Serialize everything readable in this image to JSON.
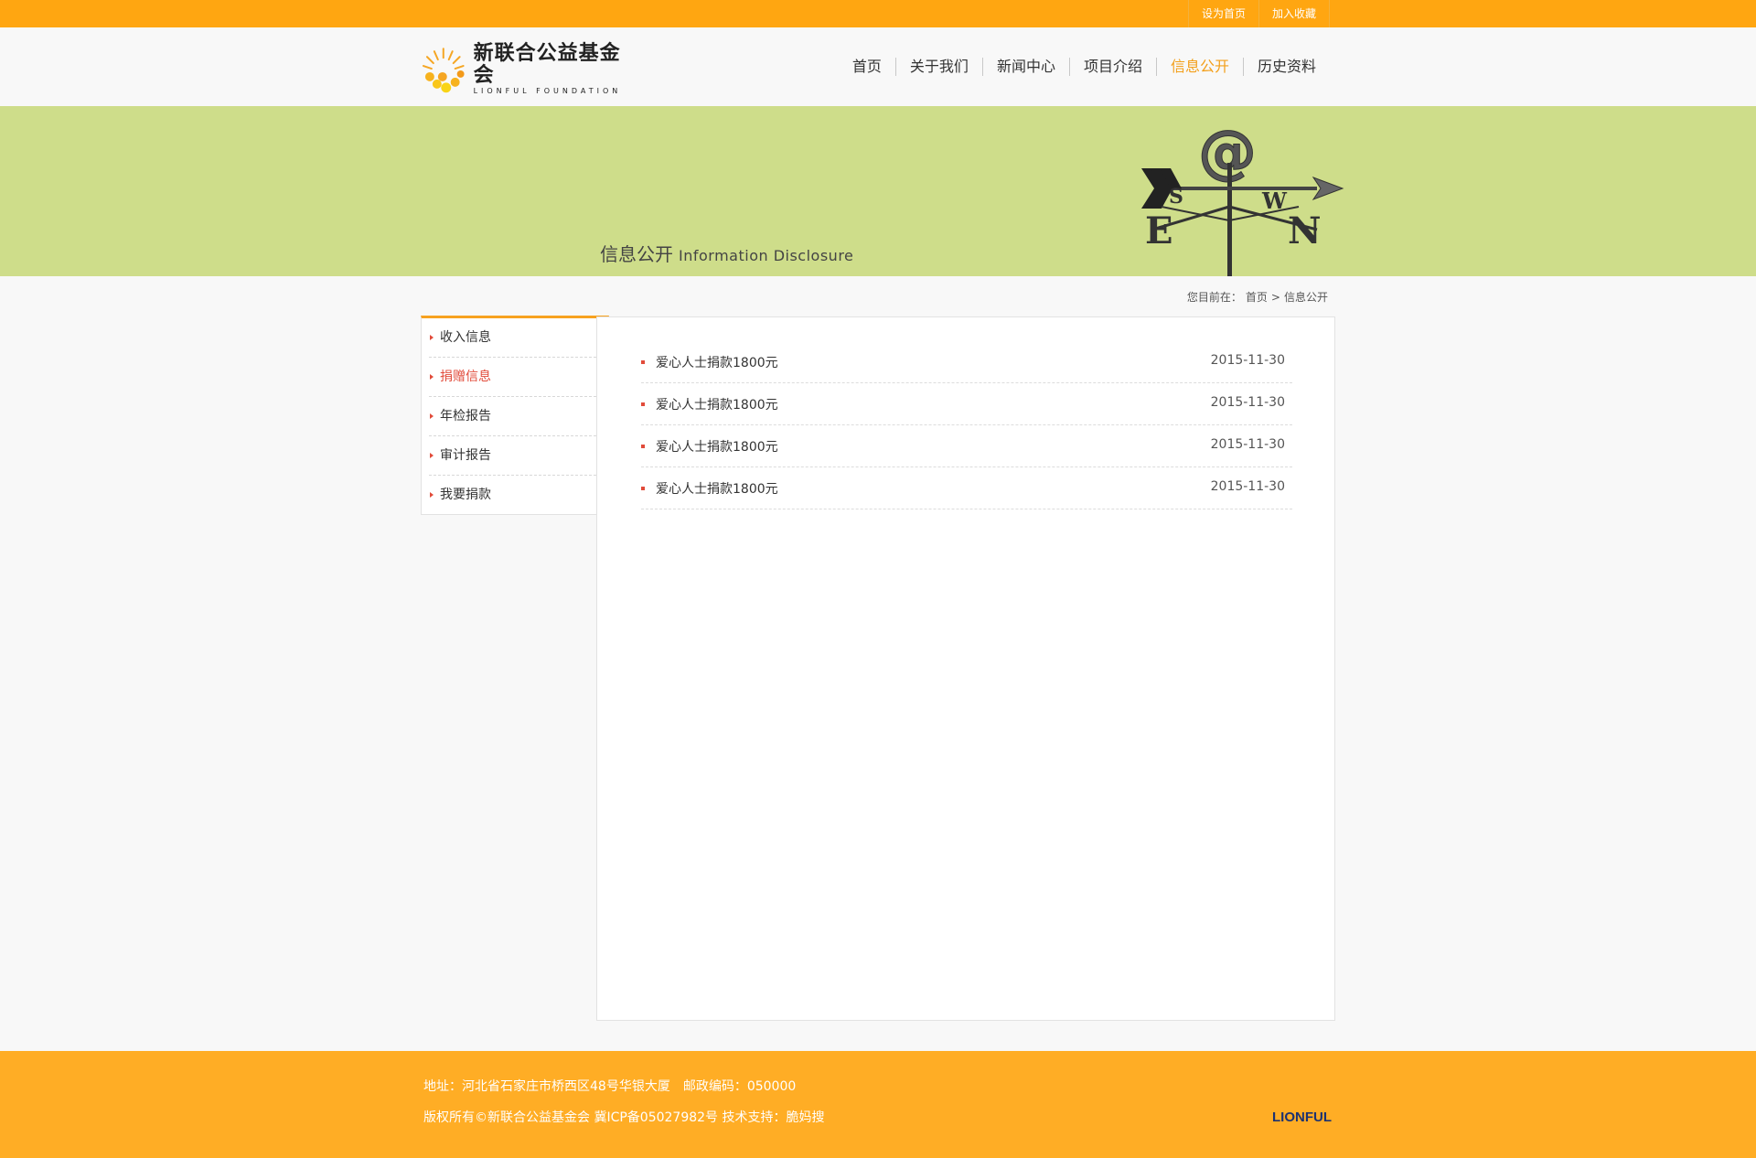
{
  "topbar": {
    "links": [
      "设为首页",
      "加入收藏"
    ]
  },
  "header": {
    "logo_cn": "新联合公益基金会",
    "logo_en": "LIONFUL FOUNDATION",
    "nav": [
      {
        "label": "首页"
      },
      {
        "label": "关于我们"
      },
      {
        "label": "新闻中心"
      },
      {
        "label": "项目介绍"
      },
      {
        "label": "信息公开",
        "active": true
      },
      {
        "label": "历史资料"
      }
    ]
  },
  "banner": {
    "title_cn": "信息公开",
    "title_en": "Information Disclosure"
  },
  "breadcrumb": {
    "prefix": "您目前在：",
    "home": "首页",
    "sep": ">",
    "current": "信息公开"
  },
  "sidebar": {
    "items": [
      {
        "label": "收入信息"
      },
      {
        "label": "捐赠信息",
        "active": true
      },
      {
        "label": "年检报告"
      },
      {
        "label": "审计报告"
      },
      {
        "label": "我要捐款"
      }
    ]
  },
  "list": {
    "rows": [
      {
        "title": "爱心人士捐款1800元",
        "date": "2015-11-30"
      },
      {
        "title": "爱心人士捐款1800元",
        "date": "2015-11-30"
      },
      {
        "title": "爱心人士捐款1800元",
        "date": "2015-11-30"
      },
      {
        "title": "爱心人士捐款1800元",
        "date": "2015-11-30"
      }
    ]
  },
  "footer": {
    "address": "地址：河北省石家庄市桥西区48号华银大厦",
    "postcode": "邮政编码：050000",
    "copyright": "版权所有©新联合公益基金会 冀ICP备05027982号 技术支持：脆妈搜",
    "logo": "LIONFUL"
  },
  "colors": {
    "accent": "#ffa611",
    "banner": "#cedd8a",
    "active_text": "#f39f1a",
    "bullet": "#e14b3a",
    "footer_logo": "#1d3270"
  }
}
